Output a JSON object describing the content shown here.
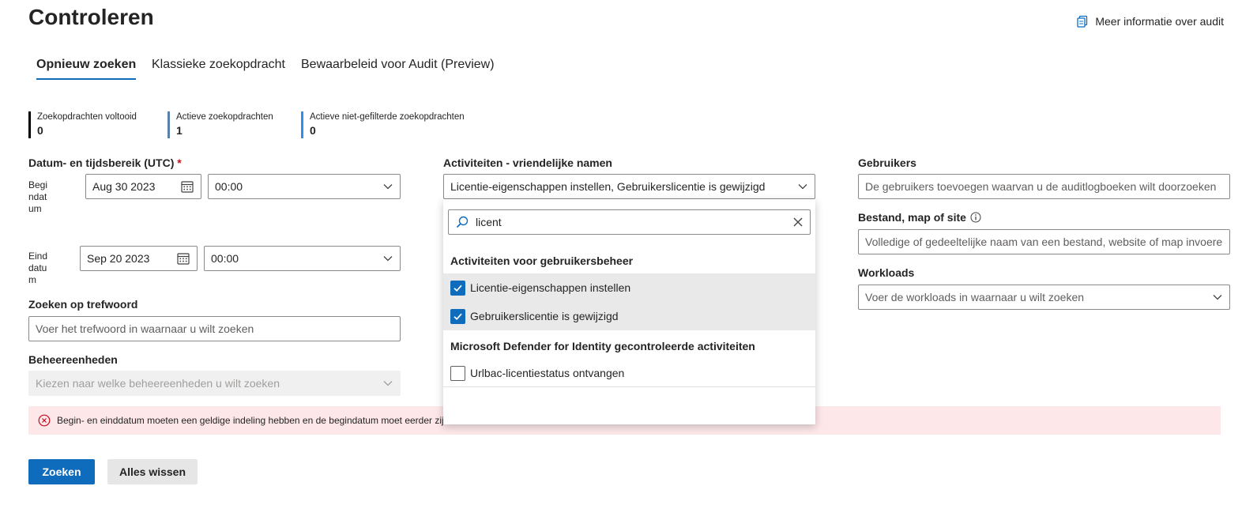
{
  "page": {
    "title": "Controleren",
    "help_link": "Meer informatie over audit"
  },
  "tabs": [
    {
      "label": "Opnieuw zoeken",
      "active": true
    },
    {
      "label": "Klassieke zoekopdracht",
      "active": false
    },
    {
      "label": "Bewaarbeleid voor Audit (Preview)",
      "active": false
    }
  ],
  "stats": [
    {
      "label": "Zoekopdrachten voltooid",
      "value": "0",
      "color": "#000000"
    },
    {
      "label": "Actieve zoekopdrachten",
      "value": "1",
      "color": "#5a7fa8"
    },
    {
      "label": "Actieve niet-gefilterde zoekopdrachten",
      "value": "0",
      "color": "#2f8ef0"
    }
  ],
  "date_range": {
    "label": "Datum- en tijdsbereik (UTC)",
    "required_marker": "*",
    "start_label_lines": [
      "Begi",
      "ndat",
      "um"
    ],
    "start_date": "Aug 30 2023",
    "start_time": "00:00",
    "end_label_lines": [
      "Eind",
      "datu",
      "m"
    ],
    "end_date": "Sep 20 2023",
    "end_time": "00:00"
  },
  "keyword": {
    "label": "Zoeken op trefwoord",
    "placeholder": "Voer het trefwoord in waarnaar u wilt zoeken"
  },
  "admin_units": {
    "label": "Beheereenheden",
    "placeholder": "Kiezen naar welke beheereenheden u wilt zoeken"
  },
  "activities": {
    "label": "Activiteiten - vriendelijke namen",
    "value": "Licentie-eigenschappen instellen, Gebruikerslicentie is gewijzigd",
    "search_value": "licent",
    "groups": [
      {
        "header": "Activiteiten voor gebruikersbeheer",
        "options": [
          {
            "label": "Licentie-eigenschappen instellen",
            "checked": true
          },
          {
            "label": "Gebruikerslicentie is gewijzigd",
            "checked": true
          }
        ]
      },
      {
        "header": "Microsoft Defender for Identity gecontroleerde activiteiten",
        "options": [
          {
            "label": "Urlbac-licentiestatus ontvangen",
            "checked": false
          }
        ]
      }
    ]
  },
  "users": {
    "label": "Gebruikers",
    "placeholder": "De gebruikers toevoegen waarvan u de auditlogboeken wilt doorzoeken"
  },
  "file": {
    "label": "Bestand, map of site",
    "placeholder": "Volledige of gedeeltelijke naam van een bestand, website of map invoeren"
  },
  "workloads": {
    "label": "Workloads",
    "placeholder": "Voer de workloads in waarnaar u wilt zoeken"
  },
  "error": {
    "message": "Begin- en einddatum moeten een geldige indeling hebben en de begindatum moet eerder zijn"
  },
  "buttons": {
    "search": "Zoeken",
    "clear": "Alles wissen"
  },
  "colors": {
    "accent": "#0f6cbd",
    "error_bg": "#fde7e9",
    "error_icon": "#c50f1f",
    "selected_option_bg": "#e9e9e9"
  }
}
